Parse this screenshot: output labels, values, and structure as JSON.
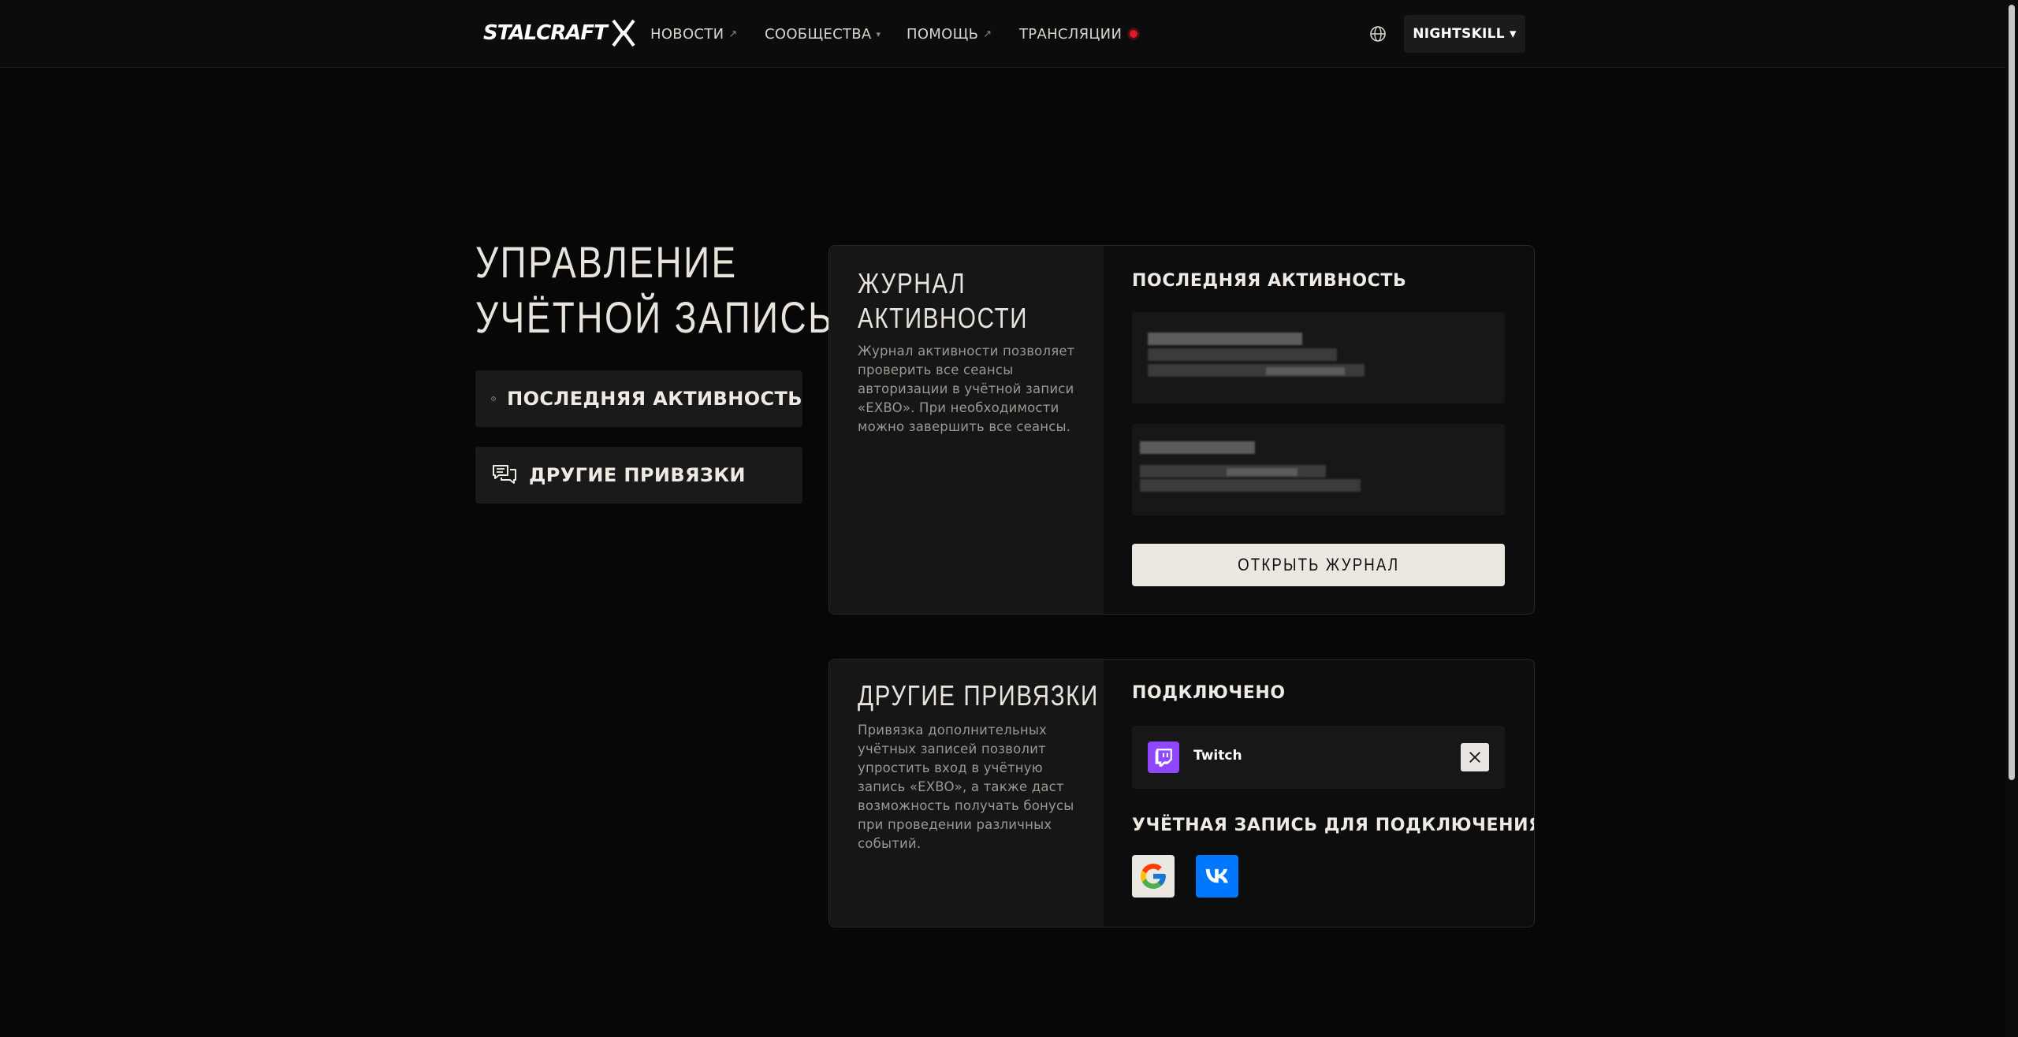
{
  "header": {
    "logo": "STALCRAFT",
    "nav": [
      {
        "label": "НОВОСТИ",
        "suffix": "↗"
      },
      {
        "label": "СООБЩЕСТВА",
        "suffix": "▾"
      },
      {
        "label": "ПОМОЩЬ",
        "suffix": "↗"
      },
      {
        "label": "ТРАНСЛЯЦИИ",
        "suffix": "live-dot"
      }
    ],
    "language_icon": "globe-icon",
    "user": {
      "name": "NIGHTSKILL",
      "caret": "▾"
    }
  },
  "sidebar": {
    "title_line1": "УПРАВЛЕНИЕ",
    "title_line2": "УЧЁТНОЙ ЗАПИСЬЮ",
    "items": [
      {
        "label": "ПОСЛЕДНЯЯ АКТИВНОСТЬ",
        "icon": "clock-icon"
      },
      {
        "label": "ДРУГИЕ ПРИВЯЗКИ",
        "icon": "chat-bubbles-icon"
      }
    ]
  },
  "activity": {
    "heading_line1": "ЖУРНАЛ",
    "heading_line2": "АКТИВНОСТИ",
    "description": "Журнал активности позволяет проверить все сеансы авторизации в учётной записи «EXBO». При необходимости можно завершить все сеансы.",
    "section_title": "ПОСЛЕДНЯЯ АКТИВНОСТЬ",
    "sessions_note": "session details are pixelated/blurred",
    "open_button": "ОТКРЫТЬ ЖУРНАЛ"
  },
  "links": {
    "heading": "ДРУГИЕ ПРИВЯЗКИ",
    "description": "Привязка дополнительных учётных записей позволит упростить вход в учётную запись «EXBO», а также даст возможность получать бонусы при проведении различных событий.",
    "connected_title": "ПОДКЛЮЧЕНО",
    "connected": [
      {
        "name": "Twitch",
        "icon": "twitch-icon",
        "color": "#9146ff"
      }
    ],
    "available_title": "УЧЁТНАЯ ЗАПИСЬ ДЛЯ ПОДКЛЮЧЕНИЯ:",
    "available": [
      {
        "icon": "google-icon",
        "bg": "#ebe7e1"
      },
      {
        "icon": "vk-icon",
        "bg": "#0077ff"
      }
    ]
  },
  "colors": {
    "background": "#070707",
    "header": "#0c0c0c",
    "panel": "#161616",
    "accent_button": "#ebe7e1",
    "live": "#e0162b"
  }
}
